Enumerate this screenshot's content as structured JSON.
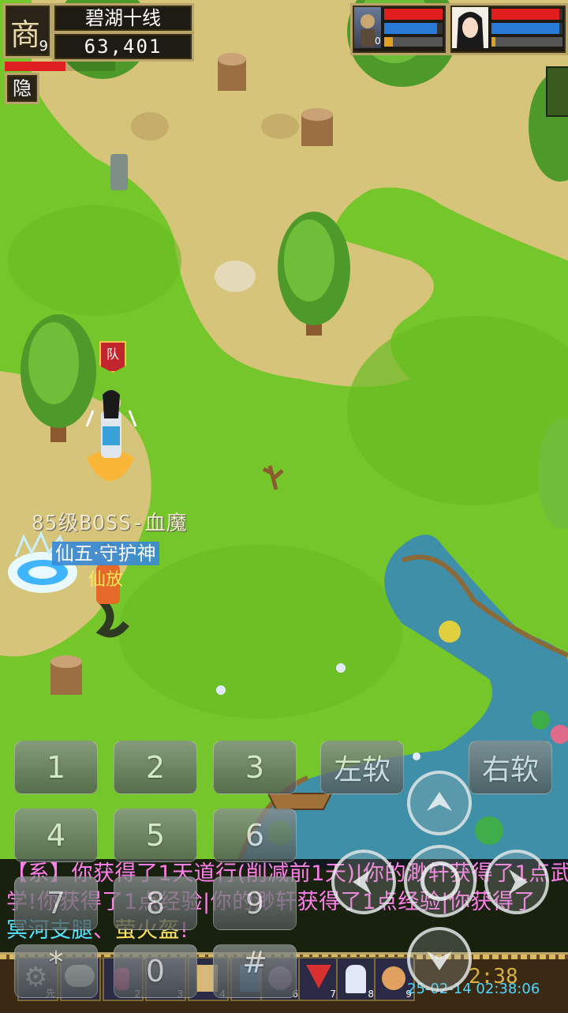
{
  "hud": {
    "map_name": "碧湖十线",
    "coords": "63,401",
    "level": "9",
    "rank_glyph": "商",
    "hide_button": "隐",
    "health_fraction": 0.55
  },
  "party": [
    {
      "name": "companion",
      "hp": 1.0,
      "mp": 0.9,
      "exp": 0.15,
      "level": "0"
    },
    {
      "name": "player",
      "hp": 0.95,
      "mp": 0.95,
      "exp": 0.05
    }
  ],
  "world": {
    "team_flag": "队",
    "npc_boss_label": "85级BOSS-血魔",
    "npc_title": "仙五·守护神",
    "npc_name": "仙放"
  },
  "keypad": {
    "k1": "1",
    "k2": "2",
    "k3": "3",
    "k4": "4",
    "k5": "5",
    "k6": "6",
    "k7": "7",
    "k8": "8",
    "k9": "9",
    "k0": "0",
    "star": "*",
    "hash": "#",
    "left_soft": "左软",
    "right_soft": "右软"
  },
  "chat": {
    "line1": "【系】你获得了1天道行(削减前1天)|你的渺轩获得了1点武",
    "line2": "学!你获得了1点经验|你的渺轩获得了1点经验|你获得了",
    "line3_a": "冥河支腿",
    "line3_b": "、",
    "line3_c": "萤火盔",
    "line3_d": "!"
  },
  "hotbar": {
    "slots": [
      "先",
      "2",
      "3",
      "4",
      "5",
      "6",
      "7",
      "8",
      "9"
    ],
    "clock": "2:38",
    "timestamp": "25-02-14 02:38:06"
  },
  "colors": {
    "chat_pink": "#ff7fe6",
    "chat_cyan": "#55e6ff",
    "chat_yellow": "#ffe65a",
    "boss_label": "#f0e6c8",
    "npc_title_bg": "#3a8ad6",
    "clock_gold": "#d8b040",
    "timestamp_cyan": "#4fd6ff"
  }
}
